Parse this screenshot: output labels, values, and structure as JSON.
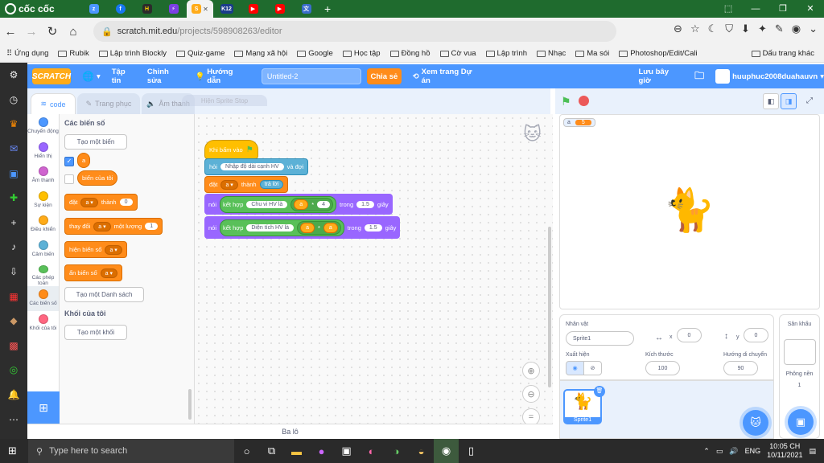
{
  "browser": {
    "brand": "cốc cốc",
    "url_host": "scratch.mit.edu",
    "url_path": "/projects/598908263/editor",
    "bookmarks": [
      "Ứng dụng",
      "Rubik",
      "Lập trình Blockly",
      "Quiz-game",
      "Mạng xã hội",
      "Google",
      "Học tập",
      "Đồng hồ",
      "Cờ vua",
      "Lập trình",
      "Nhạc",
      "Ma sói",
      "Photoshop/Edit/Cali",
      "Dấu trang khác"
    ]
  },
  "scratch": {
    "logo": "SCRATCH",
    "menu_file": "Tập tin",
    "menu_edit": "Chỉnh sửa",
    "tutorials": "Hướng dẫn",
    "title": "Untitled-2",
    "share": "Chia sẻ",
    "see_project": "Xem trang Dự án",
    "save_now": "Lưu bây giờ",
    "username": "huuphuc2008duahauvn"
  },
  "tabs": {
    "code": "code",
    "costumes": "Trang phục",
    "sounds": "Âm thanh",
    "ghost": "Hiện Sprite Stop"
  },
  "categories": [
    {
      "label": "Chuyển động",
      "color": "#4c97ff"
    },
    {
      "label": "Hiển thị",
      "color": "#9966ff"
    },
    {
      "label": "Âm thanh",
      "color": "#cf63cf"
    },
    {
      "label": "Sự kiện",
      "color": "#ffbf00"
    },
    {
      "label": "Điều khiển",
      "color": "#ffab19"
    },
    {
      "label": "Cảm biến",
      "color": "#5cb1d6"
    },
    {
      "label": "Các phép toán",
      "color": "#59c059"
    },
    {
      "label": "Các biến số",
      "color": "#ff8c1a"
    },
    {
      "label": "Khối của tôi",
      "color": "#ff6680"
    }
  ],
  "palette": {
    "header_vars": "Các biến số",
    "make_var": "Tạo một biến",
    "var_a": "a",
    "var_my": "biến của tôi",
    "set": "đặt",
    "to": "thành",
    "set_val": "0",
    "change": "thay đổi",
    "by": "một lượng",
    "change_val": "1",
    "show_var": "hiện biến số",
    "hide_var": "ẩn biến số",
    "make_list": "Tạo một Danh sách",
    "header_my": "Khối của tôi",
    "make_block": "Tạo một khối"
  },
  "script": {
    "when_flag": "Khi bấm vào",
    "ask": "hỏi",
    "ask_text": "Nhập độ dài cạnh HV",
    "and_wait": "và đợi",
    "set": "đặt",
    "var": "a",
    "to": "thành",
    "answer": "trả lời",
    "say1": {
      "say": "nói",
      "join": "kết hợp",
      "text": "Chu vi HV là",
      "var": "a",
      "op": "*",
      "num": "4",
      "for": "trong",
      "secs": "1.5",
      "unit": "giây"
    },
    "say2": {
      "say": "nói",
      "join": "kết hợp",
      "text": "Diện tích HV là",
      "var": "a",
      "op": "*",
      "var2": "a",
      "for": "trong",
      "secs": "1.5",
      "unit": "giây"
    }
  },
  "stage": {
    "monitor_name": "a",
    "monitor_value": "5"
  },
  "sprite": {
    "label": "Nhân vật",
    "name": "Sprite1",
    "x_label": "x",
    "x": "0",
    "y_label": "y",
    "y": "0",
    "show": "Xuất hiện",
    "size_label": "Kích thước",
    "size": "100",
    "dir_label": "Hướng di chuyển",
    "dir": "90",
    "thumb": "Sprite1"
  },
  "stagepanel": {
    "title": "Sân khấu",
    "backdrops": "Phông nền",
    "count": "1"
  },
  "backpack": "Ba lô",
  "taskbar": {
    "search": "Type here to search",
    "lang": "ENG",
    "time": "10:05 CH",
    "date": "10/11/2021"
  }
}
